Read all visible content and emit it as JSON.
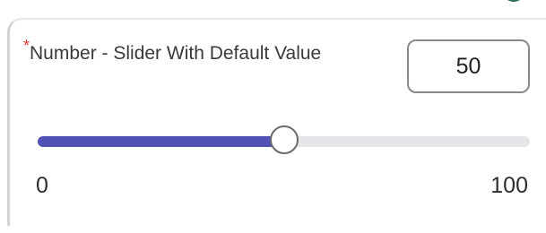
{
  "field": {
    "required_mark": "*",
    "label": "Number - Slider With Default Value",
    "value": "50"
  },
  "slider": {
    "min_label": "0",
    "max_label": "100",
    "min": 0,
    "max": 100,
    "value": 50
  },
  "colors": {
    "fill": "#4f51b4",
    "track": "#e5e5ea",
    "required": "#e53935",
    "header_accent": "#2f6b55"
  }
}
